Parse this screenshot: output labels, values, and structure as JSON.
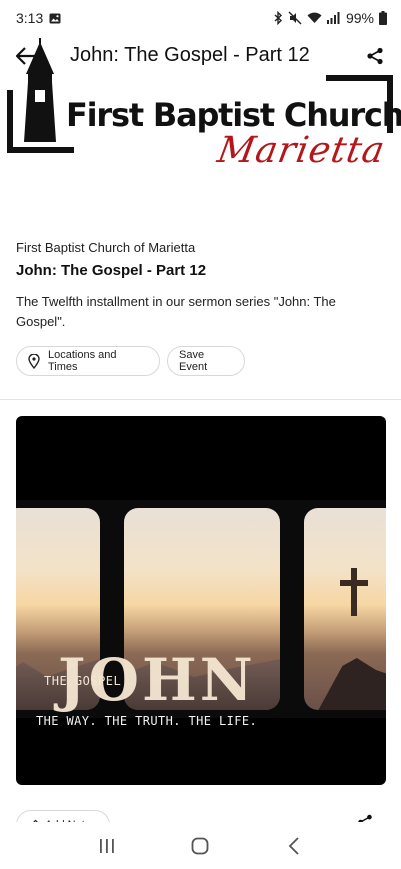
{
  "status_bar": {
    "time": "3:13",
    "battery": "99%",
    "icons": [
      "gallery-icon",
      "bluetooth-icon",
      "mute-icon",
      "wifi-icon",
      "signal-icon",
      "battery-icon"
    ]
  },
  "header": {
    "title": "John: The Gospel - Part 12",
    "back_icon": "back-arrow-icon",
    "share_icon": "share-icon"
  },
  "logo": {
    "line1": "First Baptist Church",
    "line2": "Marietta",
    "accent_color": "#b5161b"
  },
  "event": {
    "organization": "First Baptist Church of Marietta",
    "title": "John: The Gospel - Part 12",
    "description": "The Twelfth installment in our sermon series \"John: The Gospel\"."
  },
  "actions": {
    "locations_label": "Locations and Times",
    "save_label": "Save Event",
    "notes_label": "Add Notes"
  },
  "sermon_image": {
    "small_title": "THE GOSPEL",
    "big_title": "JOHN",
    "tagline": "THE WAY. THE TRUTH. THE LIFE."
  },
  "nav": {
    "recents_icon": "recents-icon",
    "home_icon": "home-icon",
    "back_icon": "nav-back-icon"
  }
}
